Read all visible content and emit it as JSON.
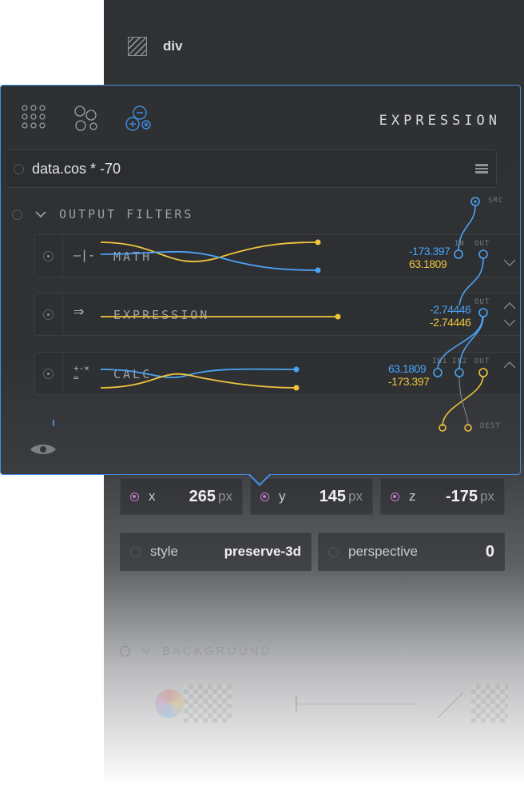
{
  "background_panel": {
    "element_title": "div",
    "transform": {
      "x": {
        "label": "x",
        "value": "265",
        "unit": "px"
      },
      "y": {
        "label": "y",
        "value": "145",
        "unit": "px"
      },
      "z": {
        "label": "z",
        "value": "-175",
        "unit": "px"
      }
    },
    "style": {
      "label": "style",
      "value": "preserve-3d"
    },
    "perspective": {
      "label": "perspective",
      "value": "0"
    },
    "section": "BACKGROUND"
  },
  "popup": {
    "title": "EXPRESSION",
    "tabs": [
      {
        "icon": "grid-dots-icon"
      },
      {
        "icon": "nodes-icon"
      },
      {
        "icon": "math-ops-icon",
        "active": true
      }
    ],
    "expression": "data.cos * -70",
    "filters_header": "OUTPUT FILTERS",
    "src_label": "SRC",
    "dest_label": "DEST",
    "filters": [
      {
        "icon": "—|-",
        "label": "MATH",
        "ports": [
          "IN",
          "OUT"
        ],
        "values": {
          "blue": "-173.397",
          "yellow": "63.1809"
        }
      },
      {
        "icon": "⇒",
        "label": "EXPRESSION",
        "ports": [
          "OUT"
        ],
        "values": {
          "blue": "-2.74446",
          "yellow": "-2.74446"
        }
      },
      {
        "icon": "+-×=",
        "label": "CALC",
        "ports": [
          "IN1",
          "IN2",
          "OUT"
        ],
        "values": {
          "blue": "63.1809",
          "yellow": "-173.397"
        }
      }
    ]
  },
  "colors": {
    "accent": "#3f8fe3",
    "blue_wire": "#4ba3f5",
    "yellow_wire": "#f0c43c",
    "magenta": "#c87bcc"
  }
}
